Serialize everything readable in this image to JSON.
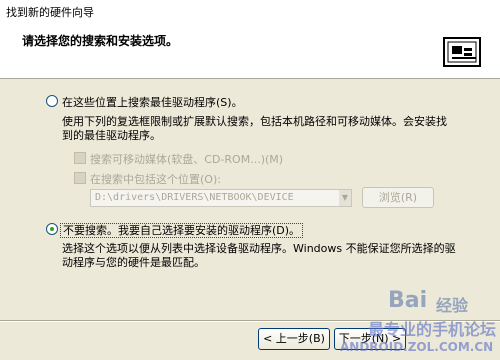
{
  "window": {
    "title": "找到新的硬件向导"
  },
  "header": {
    "heading": "请选择您的搜索和安装选项。"
  },
  "options": {
    "search": {
      "label": "在这些位置上搜索最佳驱动程序(S)。",
      "selected": false,
      "description_line1": "使用下列的复选框限制或扩展默认搜索，包括本机路径和可移动媒体。会安装找",
      "description_line2": "到的最佳驱动程序。",
      "removable_media_label": "搜索可移动媒体(软盘、CD-ROM...)(M)",
      "include_location_label": "在搜索中包括这个位置(O):",
      "path_value": "D:\\drivers\\DRIVERS\\NETBOOK\\DEVICE",
      "browse_label": "浏览(R)"
    },
    "manual": {
      "label": "不要搜索。我要自己选择要安装的驱动程序(D)。",
      "selected": true,
      "description_line1": "选择这个选项以便从列表中选择设备驱动程序。Windows 不能保证您所选择的驱",
      "description_line2": "动程序与您的硬件是最匹配。"
    }
  },
  "footer": {
    "back_label": "< 上一步(B)",
    "next_label": "下一步(N) >"
  },
  "watermark": {
    "text1": "Bai",
    "text2": "经验",
    "text3": "最专业的手机论坛",
    "text4": "ANDROID.ZOL.COM.CN"
  }
}
